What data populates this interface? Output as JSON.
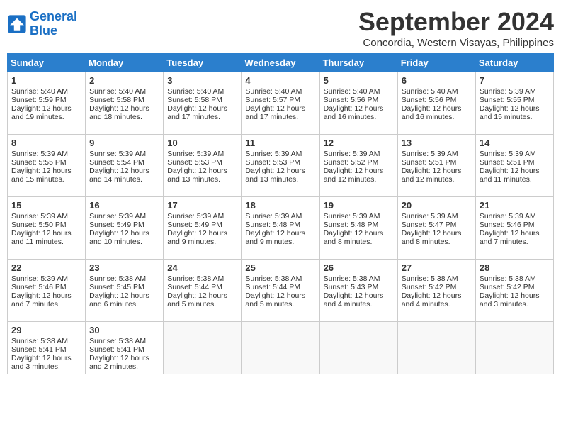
{
  "logo": {
    "line1": "General",
    "line2": "Blue"
  },
  "title": "September 2024",
  "subtitle": "Concordia, Western Visayas, Philippines",
  "weekdays": [
    "Sunday",
    "Monday",
    "Tuesday",
    "Wednesday",
    "Thursday",
    "Friday",
    "Saturday"
  ],
  "weeks": [
    [
      {
        "day": 1,
        "lines": [
          "Sunrise: 5:40 AM",
          "Sunset: 5:59 PM",
          "Daylight: 12 hours",
          "and 19 minutes."
        ]
      },
      {
        "day": 2,
        "lines": [
          "Sunrise: 5:40 AM",
          "Sunset: 5:58 PM",
          "Daylight: 12 hours",
          "and 18 minutes."
        ]
      },
      {
        "day": 3,
        "lines": [
          "Sunrise: 5:40 AM",
          "Sunset: 5:58 PM",
          "Daylight: 12 hours",
          "and 17 minutes."
        ]
      },
      {
        "day": 4,
        "lines": [
          "Sunrise: 5:40 AM",
          "Sunset: 5:57 PM",
          "Daylight: 12 hours",
          "and 17 minutes."
        ]
      },
      {
        "day": 5,
        "lines": [
          "Sunrise: 5:40 AM",
          "Sunset: 5:56 PM",
          "Daylight: 12 hours",
          "and 16 minutes."
        ]
      },
      {
        "day": 6,
        "lines": [
          "Sunrise: 5:40 AM",
          "Sunset: 5:56 PM",
          "Daylight: 12 hours",
          "and 16 minutes."
        ]
      },
      {
        "day": 7,
        "lines": [
          "Sunrise: 5:39 AM",
          "Sunset: 5:55 PM",
          "Daylight: 12 hours",
          "and 15 minutes."
        ]
      }
    ],
    [
      {
        "day": 8,
        "lines": [
          "Sunrise: 5:39 AM",
          "Sunset: 5:55 PM",
          "Daylight: 12 hours",
          "and 15 minutes."
        ]
      },
      {
        "day": 9,
        "lines": [
          "Sunrise: 5:39 AM",
          "Sunset: 5:54 PM",
          "Daylight: 12 hours",
          "and 14 minutes."
        ]
      },
      {
        "day": 10,
        "lines": [
          "Sunrise: 5:39 AM",
          "Sunset: 5:53 PM",
          "Daylight: 12 hours",
          "and 13 minutes."
        ]
      },
      {
        "day": 11,
        "lines": [
          "Sunrise: 5:39 AM",
          "Sunset: 5:53 PM",
          "Daylight: 12 hours",
          "and 13 minutes."
        ]
      },
      {
        "day": 12,
        "lines": [
          "Sunrise: 5:39 AM",
          "Sunset: 5:52 PM",
          "Daylight: 12 hours",
          "and 12 minutes."
        ]
      },
      {
        "day": 13,
        "lines": [
          "Sunrise: 5:39 AM",
          "Sunset: 5:51 PM",
          "Daylight: 12 hours",
          "and 12 minutes."
        ]
      },
      {
        "day": 14,
        "lines": [
          "Sunrise: 5:39 AM",
          "Sunset: 5:51 PM",
          "Daylight: 12 hours",
          "and 11 minutes."
        ]
      }
    ],
    [
      {
        "day": 15,
        "lines": [
          "Sunrise: 5:39 AM",
          "Sunset: 5:50 PM",
          "Daylight: 12 hours",
          "and 11 minutes."
        ]
      },
      {
        "day": 16,
        "lines": [
          "Sunrise: 5:39 AM",
          "Sunset: 5:49 PM",
          "Daylight: 12 hours",
          "and 10 minutes."
        ]
      },
      {
        "day": 17,
        "lines": [
          "Sunrise: 5:39 AM",
          "Sunset: 5:49 PM",
          "Daylight: 12 hours",
          "and 9 minutes."
        ]
      },
      {
        "day": 18,
        "lines": [
          "Sunrise: 5:39 AM",
          "Sunset: 5:48 PM",
          "Daylight: 12 hours",
          "and 9 minutes."
        ]
      },
      {
        "day": 19,
        "lines": [
          "Sunrise: 5:39 AM",
          "Sunset: 5:48 PM",
          "Daylight: 12 hours",
          "and 8 minutes."
        ]
      },
      {
        "day": 20,
        "lines": [
          "Sunrise: 5:39 AM",
          "Sunset: 5:47 PM",
          "Daylight: 12 hours",
          "and 8 minutes."
        ]
      },
      {
        "day": 21,
        "lines": [
          "Sunrise: 5:39 AM",
          "Sunset: 5:46 PM",
          "Daylight: 12 hours",
          "and 7 minutes."
        ]
      }
    ],
    [
      {
        "day": 22,
        "lines": [
          "Sunrise: 5:39 AM",
          "Sunset: 5:46 PM",
          "Daylight: 12 hours",
          "and 7 minutes."
        ]
      },
      {
        "day": 23,
        "lines": [
          "Sunrise: 5:38 AM",
          "Sunset: 5:45 PM",
          "Daylight: 12 hours",
          "and 6 minutes."
        ]
      },
      {
        "day": 24,
        "lines": [
          "Sunrise: 5:38 AM",
          "Sunset: 5:44 PM",
          "Daylight: 12 hours",
          "and 5 minutes."
        ]
      },
      {
        "day": 25,
        "lines": [
          "Sunrise: 5:38 AM",
          "Sunset: 5:44 PM",
          "Daylight: 12 hours",
          "and 5 minutes."
        ]
      },
      {
        "day": 26,
        "lines": [
          "Sunrise: 5:38 AM",
          "Sunset: 5:43 PM",
          "Daylight: 12 hours",
          "and 4 minutes."
        ]
      },
      {
        "day": 27,
        "lines": [
          "Sunrise: 5:38 AM",
          "Sunset: 5:42 PM",
          "Daylight: 12 hours",
          "and 4 minutes."
        ]
      },
      {
        "day": 28,
        "lines": [
          "Sunrise: 5:38 AM",
          "Sunset: 5:42 PM",
          "Daylight: 12 hours",
          "and 3 minutes."
        ]
      }
    ],
    [
      {
        "day": 29,
        "lines": [
          "Sunrise: 5:38 AM",
          "Sunset: 5:41 PM",
          "Daylight: 12 hours",
          "and 3 minutes."
        ]
      },
      {
        "day": 30,
        "lines": [
          "Sunrise: 5:38 AM",
          "Sunset: 5:41 PM",
          "Daylight: 12 hours",
          "and 2 minutes."
        ]
      },
      {
        "day": null,
        "lines": []
      },
      {
        "day": null,
        "lines": []
      },
      {
        "day": null,
        "lines": []
      },
      {
        "day": null,
        "lines": []
      },
      {
        "day": null,
        "lines": []
      }
    ]
  ]
}
